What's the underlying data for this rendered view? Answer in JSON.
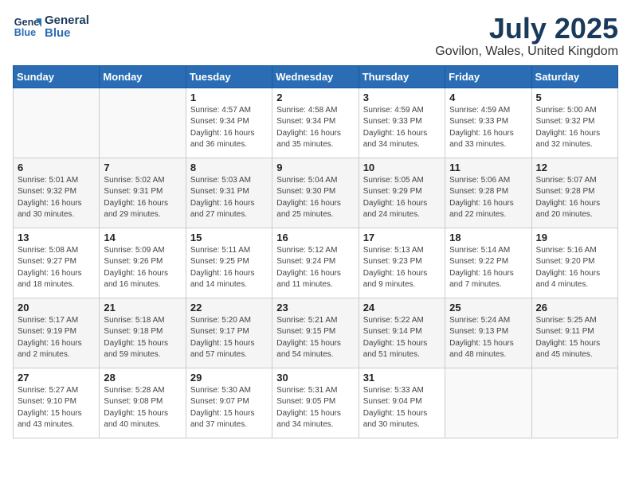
{
  "logo": {
    "line1": "General",
    "line2": "Blue"
  },
  "title": "July 2025",
  "location": "Govilon, Wales, United Kingdom",
  "days_of_week": [
    "Sunday",
    "Monday",
    "Tuesday",
    "Wednesday",
    "Thursday",
    "Friday",
    "Saturday"
  ],
  "weeks": [
    [
      {
        "day": "",
        "info": ""
      },
      {
        "day": "",
        "info": ""
      },
      {
        "day": "1",
        "info": "Sunrise: 4:57 AM\nSunset: 9:34 PM\nDaylight: 16 hours\nand 36 minutes."
      },
      {
        "day": "2",
        "info": "Sunrise: 4:58 AM\nSunset: 9:34 PM\nDaylight: 16 hours\nand 35 minutes."
      },
      {
        "day": "3",
        "info": "Sunrise: 4:59 AM\nSunset: 9:33 PM\nDaylight: 16 hours\nand 34 minutes."
      },
      {
        "day": "4",
        "info": "Sunrise: 4:59 AM\nSunset: 9:33 PM\nDaylight: 16 hours\nand 33 minutes."
      },
      {
        "day": "5",
        "info": "Sunrise: 5:00 AM\nSunset: 9:32 PM\nDaylight: 16 hours\nand 32 minutes."
      }
    ],
    [
      {
        "day": "6",
        "info": "Sunrise: 5:01 AM\nSunset: 9:32 PM\nDaylight: 16 hours\nand 30 minutes."
      },
      {
        "day": "7",
        "info": "Sunrise: 5:02 AM\nSunset: 9:31 PM\nDaylight: 16 hours\nand 29 minutes."
      },
      {
        "day": "8",
        "info": "Sunrise: 5:03 AM\nSunset: 9:31 PM\nDaylight: 16 hours\nand 27 minutes."
      },
      {
        "day": "9",
        "info": "Sunrise: 5:04 AM\nSunset: 9:30 PM\nDaylight: 16 hours\nand 25 minutes."
      },
      {
        "day": "10",
        "info": "Sunrise: 5:05 AM\nSunset: 9:29 PM\nDaylight: 16 hours\nand 24 minutes."
      },
      {
        "day": "11",
        "info": "Sunrise: 5:06 AM\nSunset: 9:28 PM\nDaylight: 16 hours\nand 22 minutes."
      },
      {
        "day": "12",
        "info": "Sunrise: 5:07 AM\nSunset: 9:28 PM\nDaylight: 16 hours\nand 20 minutes."
      }
    ],
    [
      {
        "day": "13",
        "info": "Sunrise: 5:08 AM\nSunset: 9:27 PM\nDaylight: 16 hours\nand 18 minutes."
      },
      {
        "day": "14",
        "info": "Sunrise: 5:09 AM\nSunset: 9:26 PM\nDaylight: 16 hours\nand 16 minutes."
      },
      {
        "day": "15",
        "info": "Sunrise: 5:11 AM\nSunset: 9:25 PM\nDaylight: 16 hours\nand 14 minutes."
      },
      {
        "day": "16",
        "info": "Sunrise: 5:12 AM\nSunset: 9:24 PM\nDaylight: 16 hours\nand 11 minutes."
      },
      {
        "day": "17",
        "info": "Sunrise: 5:13 AM\nSunset: 9:23 PM\nDaylight: 16 hours\nand 9 minutes."
      },
      {
        "day": "18",
        "info": "Sunrise: 5:14 AM\nSunset: 9:22 PM\nDaylight: 16 hours\nand 7 minutes."
      },
      {
        "day": "19",
        "info": "Sunrise: 5:16 AM\nSunset: 9:20 PM\nDaylight: 16 hours\nand 4 minutes."
      }
    ],
    [
      {
        "day": "20",
        "info": "Sunrise: 5:17 AM\nSunset: 9:19 PM\nDaylight: 16 hours\nand 2 minutes."
      },
      {
        "day": "21",
        "info": "Sunrise: 5:18 AM\nSunset: 9:18 PM\nDaylight: 15 hours\nand 59 minutes."
      },
      {
        "day": "22",
        "info": "Sunrise: 5:20 AM\nSunset: 9:17 PM\nDaylight: 15 hours\nand 57 minutes."
      },
      {
        "day": "23",
        "info": "Sunrise: 5:21 AM\nSunset: 9:15 PM\nDaylight: 15 hours\nand 54 minutes."
      },
      {
        "day": "24",
        "info": "Sunrise: 5:22 AM\nSunset: 9:14 PM\nDaylight: 15 hours\nand 51 minutes."
      },
      {
        "day": "25",
        "info": "Sunrise: 5:24 AM\nSunset: 9:13 PM\nDaylight: 15 hours\nand 48 minutes."
      },
      {
        "day": "26",
        "info": "Sunrise: 5:25 AM\nSunset: 9:11 PM\nDaylight: 15 hours\nand 45 minutes."
      }
    ],
    [
      {
        "day": "27",
        "info": "Sunrise: 5:27 AM\nSunset: 9:10 PM\nDaylight: 15 hours\nand 43 minutes."
      },
      {
        "day": "28",
        "info": "Sunrise: 5:28 AM\nSunset: 9:08 PM\nDaylight: 15 hours\nand 40 minutes."
      },
      {
        "day": "29",
        "info": "Sunrise: 5:30 AM\nSunset: 9:07 PM\nDaylight: 15 hours\nand 37 minutes."
      },
      {
        "day": "30",
        "info": "Sunrise: 5:31 AM\nSunset: 9:05 PM\nDaylight: 15 hours\nand 34 minutes."
      },
      {
        "day": "31",
        "info": "Sunrise: 5:33 AM\nSunset: 9:04 PM\nDaylight: 15 hours\nand 30 minutes."
      },
      {
        "day": "",
        "info": ""
      },
      {
        "day": "",
        "info": ""
      }
    ]
  ]
}
